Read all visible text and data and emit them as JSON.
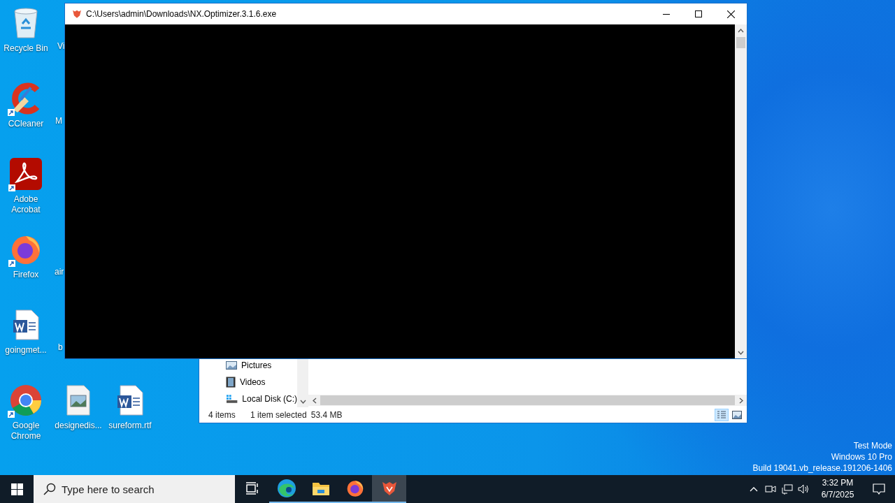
{
  "desktop_icons": [
    {
      "label": "Recycle Bin",
      "kind": "recycle",
      "shortcut": false
    },
    {
      "label": "CCleaner",
      "kind": "ccleaner",
      "shortcut": true
    },
    {
      "label": "Adobe Acrobat",
      "kind": "acrobat",
      "shortcut": true
    },
    {
      "label": "Firefox",
      "kind": "firefox",
      "shortcut": true
    },
    {
      "label": "goingmet...",
      "kind": "word",
      "shortcut": false
    },
    {
      "label": "Google Chrome",
      "kind": "chrome",
      "shortcut": true
    },
    {
      "label": "designedis...",
      "kind": "image",
      "shortcut": false
    },
    {
      "label": "sureform.rtf",
      "kind": "word",
      "shortcut": false
    }
  ],
  "covered_icon_labels": [
    "Vi",
    "M",
    "air",
    "b"
  ],
  "console_window": {
    "title": "C:\\Users\\admin\\Downloads\\NX.Optimizer.3.1.6.exe"
  },
  "explorer_window": {
    "nav_items": [
      {
        "label": "Pictures",
        "kind": "pictures"
      },
      {
        "label": "Videos",
        "kind": "videos"
      },
      {
        "label": "Local Disk (C:)",
        "kind": "disk"
      }
    ],
    "status": {
      "item_count": "4 items",
      "selection": "1 item selected",
      "size": "53.4 MB"
    },
    "views": [
      {
        "kind": "details",
        "selected": true
      },
      {
        "kind": "thumbnails",
        "selected": false
      }
    ]
  },
  "system_notice": [
    "Test Mode",
    "Windows 10 Pro",
    "Build 19041.vb_release.191206-1406"
  ],
  "taskbar": {
    "search": {
      "placeholder": "Type here to search"
    },
    "apps": [
      {
        "kind": "taskview",
        "running": false,
        "selected": false
      },
      {
        "kind": "edge",
        "running": true,
        "selected": false
      },
      {
        "kind": "explorer",
        "running": true,
        "selected": false
      },
      {
        "kind": "firefox",
        "running": true,
        "selected": false
      },
      {
        "kind": "nx",
        "running": true,
        "selected": true
      }
    ],
    "time": "3:32 PM",
    "date": "6/7/2025"
  }
}
